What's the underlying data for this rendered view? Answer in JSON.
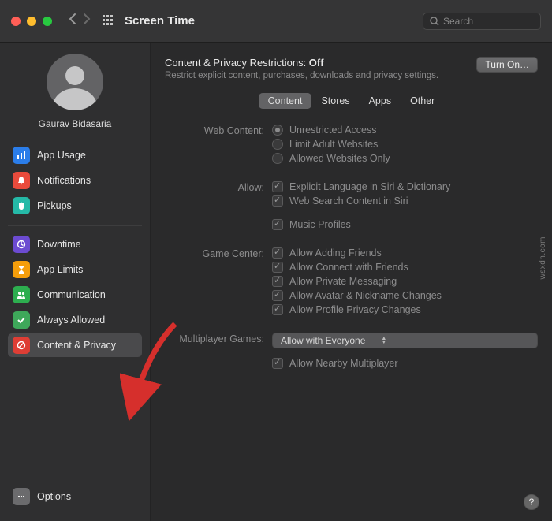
{
  "toolbar": {
    "title": "Screen Time",
    "search_placeholder": "Search"
  },
  "sidebar": {
    "username": "Gaurav Bidasaria",
    "groups": [
      {
        "items": [
          {
            "label": "App Usage"
          },
          {
            "label": "Notifications"
          },
          {
            "label": "Pickups"
          }
        ]
      },
      {
        "items": [
          {
            "label": "Downtime"
          },
          {
            "label": "App Limits"
          },
          {
            "label": "Communication"
          },
          {
            "label": "Always Allowed"
          },
          {
            "label": "Content & Privacy"
          }
        ]
      }
    ],
    "options_label": "Options"
  },
  "panel": {
    "header_prefix": "Content & Privacy Restrictions: ",
    "header_state": "Off",
    "header_sub": "Restrict explicit content, purchases, downloads and privacy settings.",
    "turn_on_label": "Turn On…",
    "tabs": [
      "Content",
      "Stores",
      "Apps",
      "Other"
    ],
    "rows": {
      "web_content": {
        "label": "Web Content:",
        "options": [
          "Unrestricted Access",
          "Limit Adult Websites",
          "Allowed Websites Only"
        ]
      },
      "allow": {
        "label": "Allow:",
        "options": [
          "Explicit Language in Siri & Dictionary",
          "Web Search Content in Siri",
          "Music Profiles"
        ]
      },
      "game_center": {
        "label": "Game Center:",
        "options": [
          "Allow Adding Friends",
          "Allow Connect with Friends",
          "Allow Private Messaging",
          "Allow Avatar & Nickname Changes",
          "Allow Profile Privacy Changes"
        ]
      },
      "multiplayer": {
        "label": "Multiplayer Games:",
        "select": "Allow with Everyone",
        "nearby": "Allow Nearby Multiplayer"
      }
    }
  },
  "watermark": "wsxdn.com"
}
